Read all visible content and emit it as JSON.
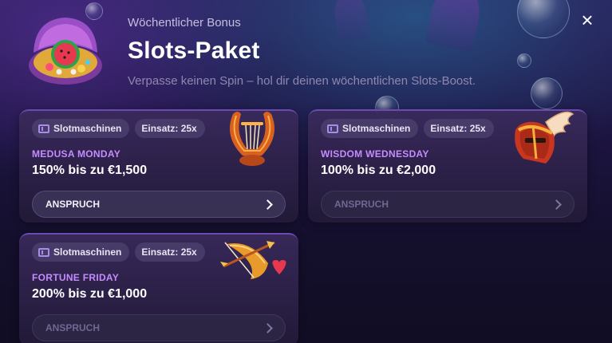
{
  "header": {
    "eyebrow": "Wöchentlicher Bonus",
    "title": "Slots-Paket",
    "subtitle": "Verpasse keinen Spin – hol dir deinen wöchentlichen Slots-Boost.",
    "close_icon": "×"
  },
  "cards": [
    {
      "tag_category": "Slotmaschinen",
      "tag_wager": "Einsatz: 25x",
      "day": "MEDUSA MONDAY",
      "offer": "150% bis zu €1,500",
      "button": "ANSPRUCH",
      "button_state": "active",
      "art": "lyre-icon"
    },
    {
      "tag_category": "Slotmaschinen",
      "tag_wager": "Einsatz: 25x",
      "day": "WISDOM WEDNESDAY",
      "offer": "100% bis zu €2,000",
      "button": "ANSPRUCH",
      "button_state": "disabled",
      "art": "winged-helmet-icon"
    },
    {
      "tag_category": "Slotmaschinen",
      "tag_wager": "Einsatz: 25x",
      "day": "FORTUNE FRIDAY",
      "offer": "200% bis zu €1,000",
      "button": "ANSPRUCH",
      "button_state": "disabled",
      "art": "bow-and-arrow-icon"
    }
  ],
  "colors": {
    "accent_purple": "#c48cff",
    "background": "#1c1440"
  }
}
